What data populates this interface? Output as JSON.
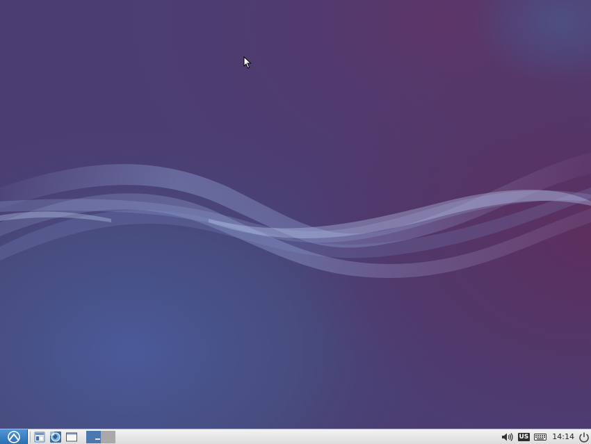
{
  "desktop": {
    "colors": {
      "base": "#4b3d72",
      "purple": "#5a3466",
      "blue": "#3f5a8c",
      "ribbon": "#8ea6d8"
    }
  },
  "taskbar": {
    "menu_icon": "lubuntu-logo-icon",
    "launchers": [
      {
        "name": "file-manager-icon"
      },
      {
        "name": "web-browser-icon"
      },
      {
        "name": "show-desktop-icon"
      }
    ],
    "workspaces": [
      {
        "label": "",
        "active": true
      },
      {
        "label": "",
        "active": false
      }
    ],
    "tray": {
      "volume_icon": "volume-icon",
      "keyboard_layout": "US",
      "keyboard_icon": "keyboard-icon",
      "clock": "14:14",
      "power_icon": "power-icon"
    }
  }
}
